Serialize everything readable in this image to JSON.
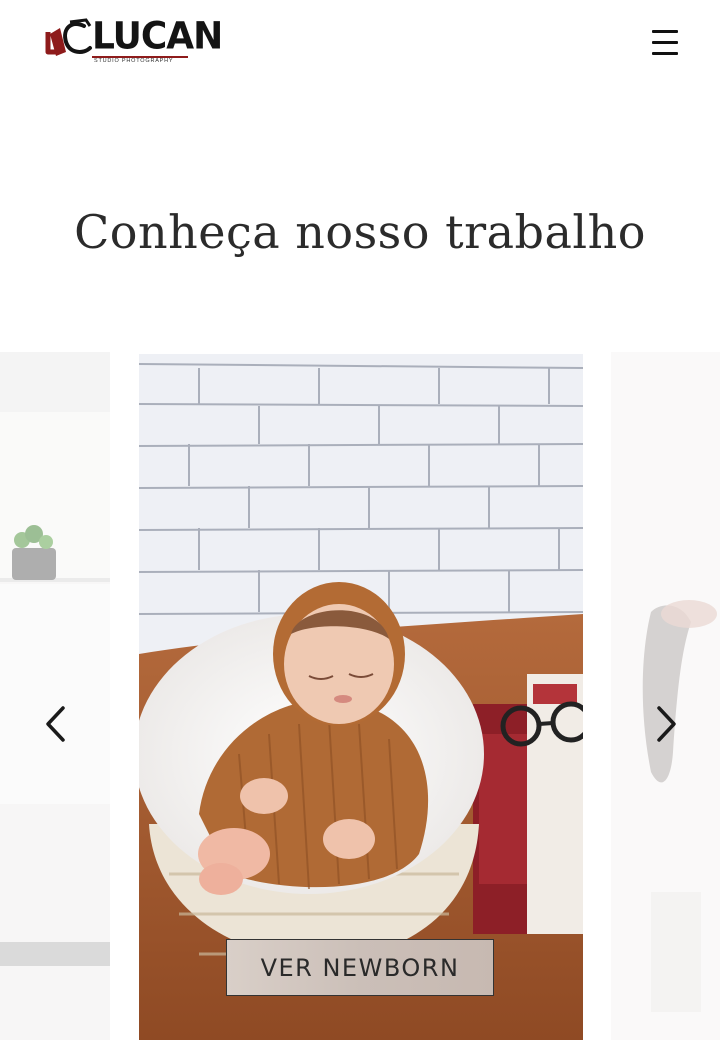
{
  "header": {
    "logo_text": "LUCAN",
    "logo_subtitle": "STUDIO PHOTOGRAPHY",
    "menu_icon": "hamburger-menu-icon"
  },
  "section": {
    "title": "Conheça nosso trabalho"
  },
  "carousel": {
    "prev_icon": "chevron-left-icon",
    "next_icon": "chevron-right-icon",
    "current_slide": {
      "button_label": "VER NEWBORN"
    }
  },
  "colors": {
    "brand_red": "#8e1b1b",
    "text_dark": "#2b2b2b",
    "button_bg": "#cbbfb8"
  }
}
